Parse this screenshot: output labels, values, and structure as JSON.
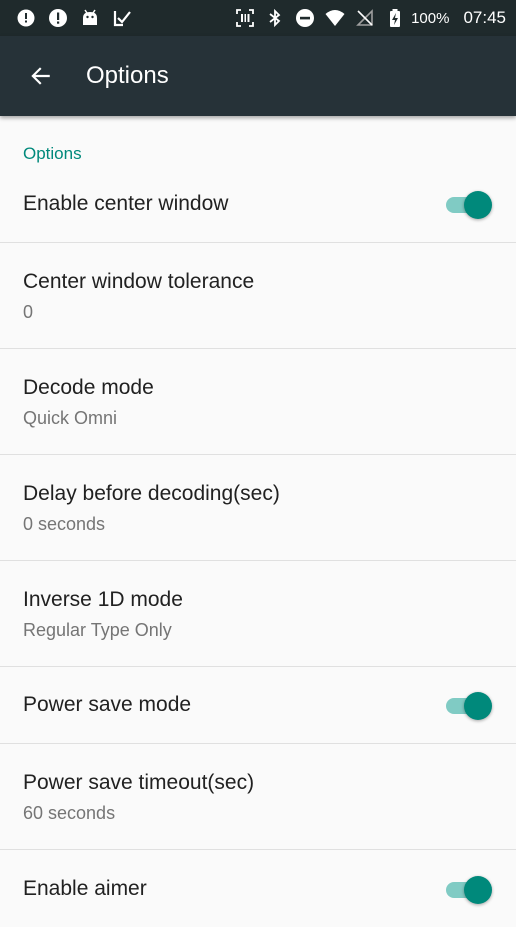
{
  "status_bar": {
    "left_icons": [
      "message-icon",
      "alert-icon",
      "android-icon",
      "check-icon"
    ],
    "right_icons": [
      "scanner-icon",
      "bluetooth-icon",
      "do-not-disturb-icon",
      "wifi-icon",
      "no-sim-icon",
      "battery-charging-icon"
    ],
    "battery_percent": "100%",
    "time": "07:45"
  },
  "app_bar": {
    "title": "Options",
    "back_icon": "arrow-back-icon"
  },
  "colors": {
    "status_bar": "#1f2a2c",
    "app_bar": "#263238",
    "accent": "#00897b",
    "accent_light": "#80cbc4",
    "background": "#fafafa"
  },
  "section": {
    "header": "Options"
  },
  "preferences": [
    {
      "title": "Enable center window",
      "type": "switch",
      "checked": true
    },
    {
      "title": "Center window tolerance",
      "summary": "0",
      "type": "text"
    },
    {
      "title": "Decode mode",
      "summary": "Quick Omni",
      "type": "list"
    },
    {
      "title": "Delay before decoding(sec)",
      "summary": "0 seconds",
      "type": "text"
    },
    {
      "title": "Inverse 1D mode",
      "summary": "Regular Type Only",
      "type": "list"
    },
    {
      "title": "Power save mode",
      "type": "switch",
      "checked": true
    },
    {
      "title": "Power save timeout(sec)",
      "summary": "60 seconds",
      "type": "text"
    },
    {
      "title": "Enable aimer",
      "type": "switch",
      "checked": true
    }
  ]
}
